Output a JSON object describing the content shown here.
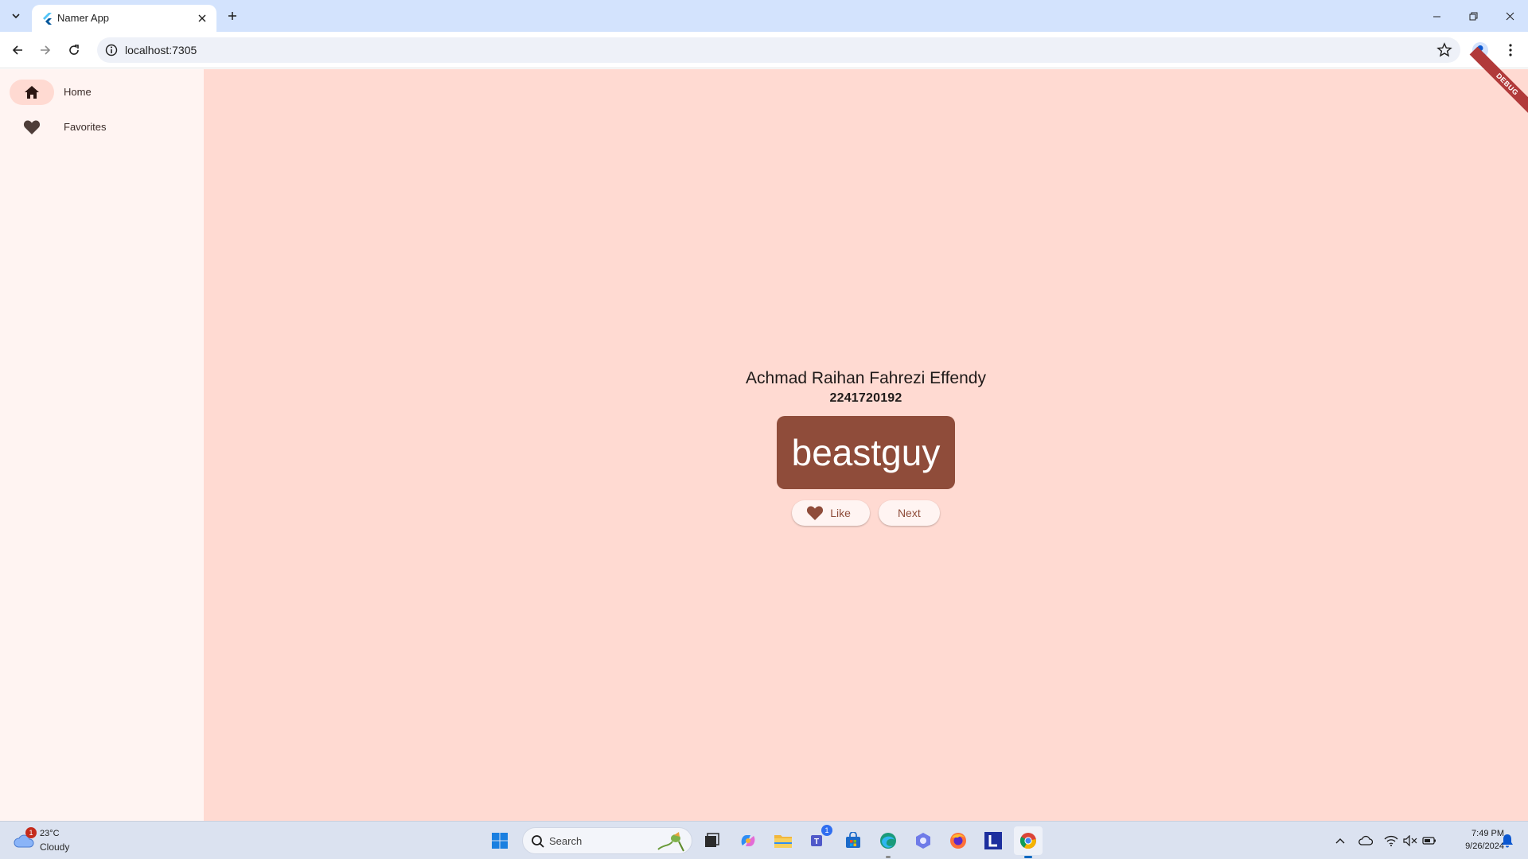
{
  "browser": {
    "tab_title": "Namer App",
    "url": "localhost:7305"
  },
  "rail": {
    "items": [
      {
        "label": "Home",
        "icon": "home-icon",
        "active": true
      },
      {
        "label": "Favorites",
        "icon": "heart-icon",
        "active": false
      }
    ]
  },
  "main": {
    "name": "Achmad Raihan Fahrezi Effendy",
    "student_id": "2241720192",
    "word_pair": "beastguy",
    "like_label": "Like",
    "next_label": "Next",
    "debug_banner": "DEBUG"
  },
  "taskbar": {
    "weather_temp": "23°C",
    "weather_condition": "Cloudy",
    "weather_badge": "1",
    "search_label": "Search",
    "teams_badge": "1",
    "time": "7:49 PM",
    "date": "9/26/2024"
  },
  "colors": {
    "primary": "#8f4c3a",
    "surface": "#ffdad2",
    "rail": "#fff4f2",
    "chrome_tabbar": "#d3e3fd"
  }
}
